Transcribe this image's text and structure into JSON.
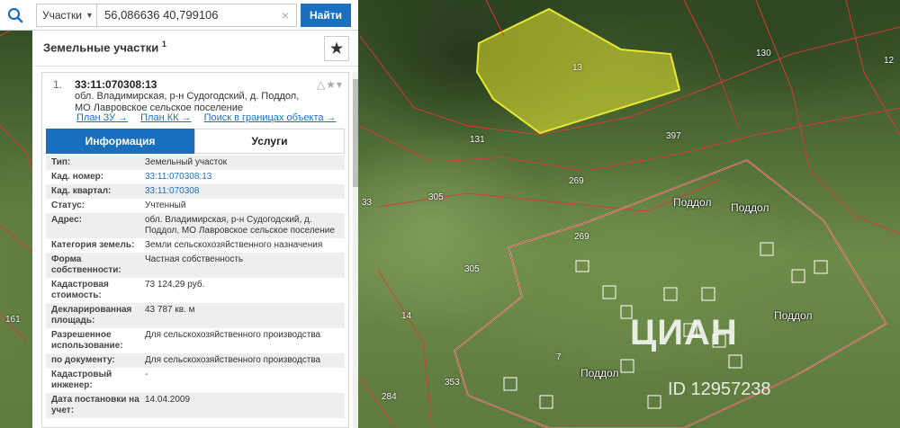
{
  "search": {
    "type_label": "Участки",
    "query": "56,086636 40,799106",
    "find_label": "Найти"
  },
  "panel": {
    "title": "Земельные участки",
    "count": "1"
  },
  "card": {
    "index": "1.",
    "cadastral_number": "33:11:070308:13",
    "address": "обл. Владимирская, р-н Судогодский, д. Поддол, МО Лавровское сельское поселение",
    "links": [
      "План ЗУ →",
      "План КК →",
      "Поиск в границах объекта →"
    ],
    "tabs": [
      "Информация",
      "Услуги"
    ]
  },
  "info_rows": [
    {
      "k": "Тип:",
      "v": "Земельный участок"
    },
    {
      "k": "Кад. номер:",
      "v": "33:11:070308:13"
    },
    {
      "k": "Кад. квартал:",
      "v": "33:11:070308"
    },
    {
      "k": "Статус:",
      "v": "Учтенный"
    },
    {
      "k": "Адрес:",
      "v": "обл. Владимирская, р-н Судогодский, д. Поддол, МО Лавровское сельское поселение"
    },
    {
      "k": "Категория земель:",
      "v": "Земли сельскохозяйственного назначения"
    },
    {
      "k": "Форма собственности:",
      "v": "Частная собственность"
    },
    {
      "k": "Кадастровая стоимость:",
      "v": "73 124,29 руб."
    },
    {
      "k": "Декларированная площадь:",
      "v": "43 787 кв. м"
    },
    {
      "k": "Разрешенное использование:",
      "v": "Для сельскохозяйственного производства"
    },
    {
      "k": "по документу:",
      "v": "Для сельскохозяйственного производства"
    },
    {
      "k": "Кадастровый инженер:",
      "v": "-"
    },
    {
      "k": "Дата постановки на учет:",
      "v": "14.04.2009"
    }
  ],
  "map": {
    "parcel_labels": [
      "13",
      "130",
      "12",
      "397",
      "269",
      "305",
      "131",
      "269",
      "305",
      "14",
      "7",
      "353",
      "284",
      "33",
      "161"
    ],
    "village_labels": [
      "Поддол",
      "Поддол",
      "Поддол",
      "Поддол"
    ],
    "highlight_color": "#e8e832"
  },
  "watermark": {
    "brand": "ЦИАН",
    "id": "ID 12957238"
  }
}
